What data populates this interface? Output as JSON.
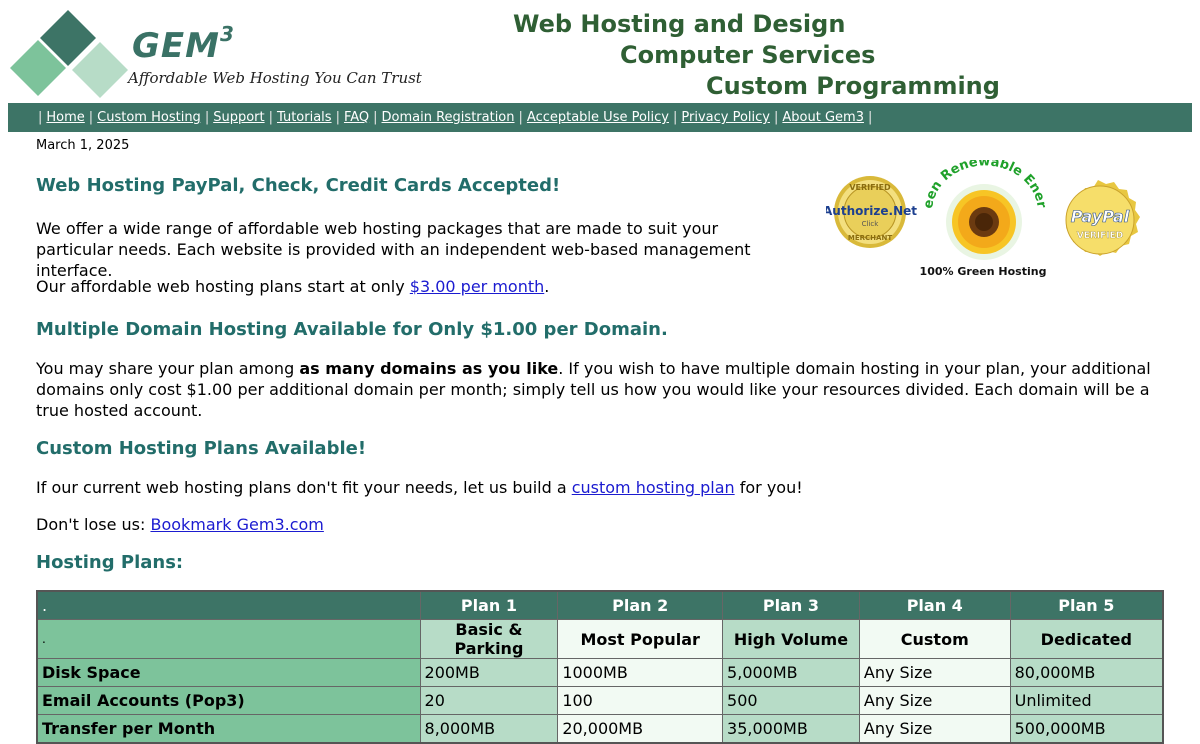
{
  "header": {
    "logo_word": "GEM",
    "logo_sup": "3",
    "tagline": "Affordable Web Hosting You Can Trust",
    "services": [
      "Web Hosting and Design",
      "Computer Services",
      "Custom Programming"
    ]
  },
  "nav": {
    "items": [
      "Home",
      "Custom Hosting",
      "Support",
      "Tutorials",
      "FAQ",
      "Domain Registration",
      "Acceptable Use Policy",
      "Privacy Policy",
      "About Gem3"
    ],
    "separator": "|"
  },
  "date": "March 1, 2025",
  "sections": {
    "paypal_heading": "Web Hosting PayPal, Check, Credit Cards Accepted!",
    "intro_text": "We offer a wide range of affordable web hosting packages that are made to suit your particular needs. Each website is provided with an independent web-based management interface.",
    "plans_start_prefix": "Our affordable web hosting plans start at only ",
    "plans_start_link": "$3.00 per month",
    "plans_start_suffix": ".",
    "multi_heading": "Multiple Domain Hosting Available for Only $1.00 per Domain.",
    "multi_prefix": "You may share your plan among ",
    "multi_bold": "as many domains as you like",
    "multi_suffix": ". If you wish to have multiple domain hosting in your plan, your additional domains only cost $1.00 per additional domain per month; simply tell us how you would like your resources divided. Each domain will be a true hosted account.",
    "custom_heading": "Custom Hosting Plans Available!",
    "custom_prefix": "If our current web hosting plans don't fit your needs, let us build a ",
    "custom_link": "custom hosting plan",
    "custom_suffix": " for you!",
    "bookmark_prefix": "Don't lose us: ",
    "bookmark_link": "Bookmark Gem3.com",
    "hosting_plans_heading": "Hosting Plans:"
  },
  "badges": {
    "authorize_top": "VERIFIED",
    "authorize_name": "Authorize.Net",
    "authorize_click": "Click",
    "authorize_bottom": "MERCHANT",
    "green_arc": "Green Renewable Energy",
    "green_caption": "100% Green Hosting",
    "paypal_name": "PayPal",
    "paypal_verified": "VERIFIED"
  },
  "table": {
    "corner": ".",
    "corner2": ".",
    "plans": [
      "Plan 1",
      "Plan 2",
      "Plan 3",
      "Plan 4",
      "Plan 5"
    ],
    "subtitles": [
      "Basic & Parking",
      "Most Popular",
      "High Volume",
      "Custom",
      "Dedicated"
    ],
    "rows": [
      {
        "label": "Disk Space",
        "values": [
          "200MB",
          "1000MB",
          "5,000MB",
          "Any Size",
          "80,000MB"
        ]
      },
      {
        "label": "Email Accounts (Pop3)",
        "values": [
          "20",
          "100",
          "500",
          "Any Size",
          "Unlimited"
        ]
      },
      {
        "label": "Transfer per Month",
        "values": [
          "8,000MB",
          "20,000MB",
          "35,000MB",
          "Any Size",
          "500,000MB"
        ]
      }
    ]
  },
  "colors": {
    "nav_bg": "#3d7466",
    "heading": "#226d6a",
    "services": "#2f5f34",
    "link": "#1b1bd0",
    "label_cell": "#7dc39b",
    "light_cell": "#b7dcc7",
    "pale_cell": "#f2faf3"
  }
}
